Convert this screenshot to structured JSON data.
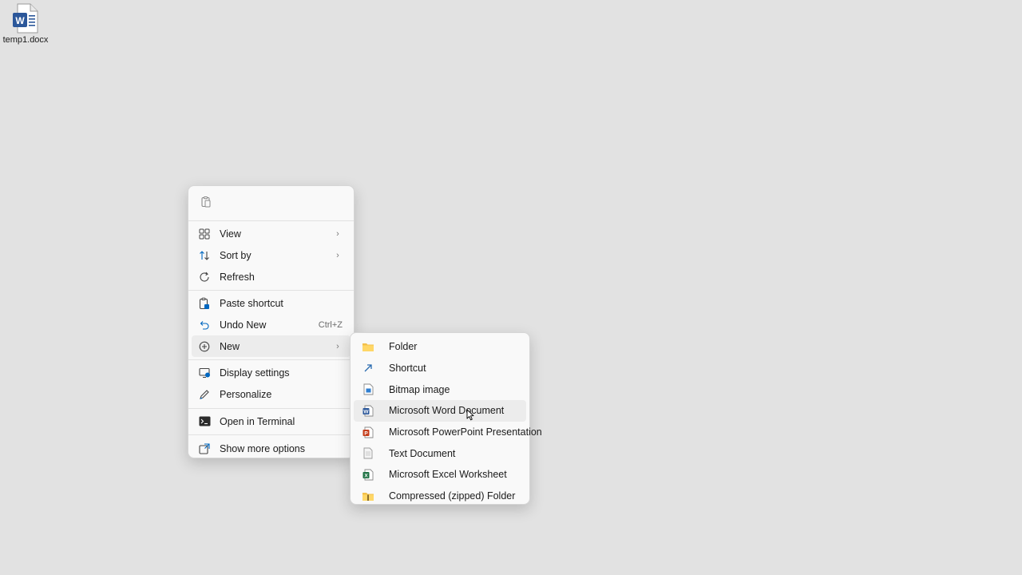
{
  "desktop": {
    "icon_label": "temp1.docx",
    "icon_type": "word-document-icon"
  },
  "context_menu": {
    "top_actions": [
      {
        "icon": "paste-icon"
      }
    ],
    "items": [
      {
        "label": "View",
        "icon": "grid-view-icon",
        "submenu": true
      },
      {
        "label": "Sort by",
        "icon": "sort-icon",
        "submenu": true
      },
      {
        "label": "Refresh",
        "icon": "refresh-icon"
      },
      {
        "label": "Paste shortcut",
        "icon": "paste-shortcut-icon"
      },
      {
        "label": "Undo New",
        "icon": "undo-icon",
        "shortcut": "Ctrl+Z"
      },
      {
        "label": "New",
        "icon": "new-plus-icon",
        "submenu": true,
        "active": true
      },
      {
        "label": "Display settings",
        "icon": "display-settings-icon"
      },
      {
        "label": "Personalize",
        "icon": "personalize-pen-icon"
      },
      {
        "label": "Open in Terminal",
        "icon": "terminal-icon"
      },
      {
        "label": "Show more options",
        "icon": "show-more-icon"
      }
    ]
  },
  "new_submenu": {
    "items": [
      {
        "label": "Folder",
        "icon": "folder-icon"
      },
      {
        "label": "Shortcut",
        "icon": "shortcut-arrow-icon"
      },
      {
        "label": "Bitmap image",
        "icon": "bitmap-icon"
      },
      {
        "label": "Microsoft Word Document",
        "icon": "word-icon",
        "hovered": true
      },
      {
        "label": "Microsoft PowerPoint Presentation",
        "icon": "powerpoint-icon"
      },
      {
        "label": "Text Document",
        "icon": "text-document-icon"
      },
      {
        "label": "Microsoft Excel Worksheet",
        "icon": "excel-icon"
      },
      {
        "label": "Compressed (zipped) Folder",
        "icon": "zip-folder-icon"
      }
    ]
  },
  "colors": {
    "desktop_bg": "#e2e2e2",
    "menu_bg": "#f9f9f9",
    "accent": "#0067c0"
  }
}
